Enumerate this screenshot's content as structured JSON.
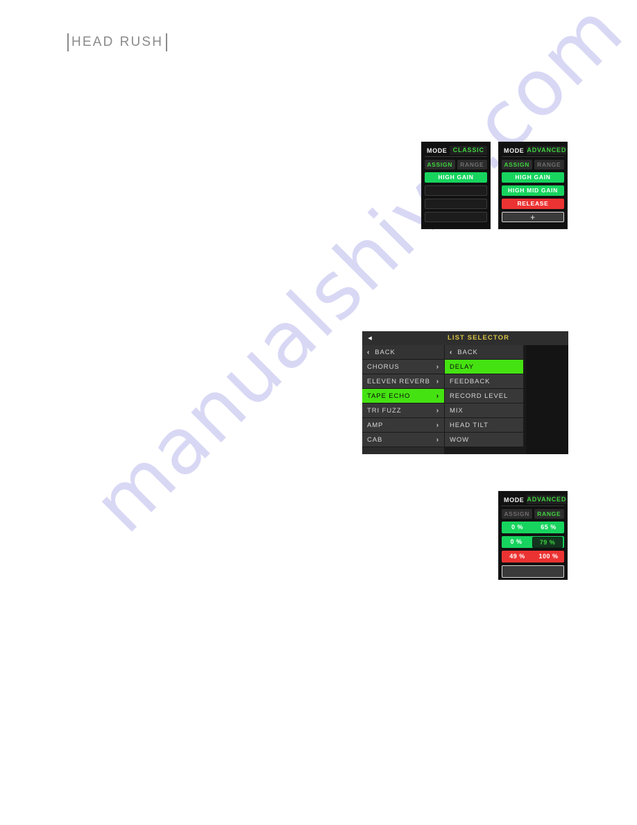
{
  "brand": {
    "name": "HEADRUSH",
    "word_head": "HEAD",
    "word_rush": "RUSH"
  },
  "watermark": {
    "text": "manualshive.com",
    "color": "#ccccf2"
  },
  "colors": {
    "accent_green": "#17d45e",
    "bright_green": "#45e212",
    "text_green": "#3fd43f",
    "red": "#ec3333",
    "title_yellow": "#d8c247",
    "panel_dark": "#111111",
    "row_gray": "#383838"
  },
  "assign_panel_classic": {
    "mode_label": "MODE",
    "mode_value": "CLASSIC",
    "tabs": [
      {
        "label": "ASSIGN",
        "active": true
      },
      {
        "label": "RANGE",
        "active": false
      }
    ],
    "slots": [
      {
        "label": "HIGH GAIN",
        "state": "green"
      },
      {
        "label": "",
        "state": "empty"
      },
      {
        "label": "",
        "state": "empty"
      },
      {
        "label": "",
        "state": "empty"
      }
    ]
  },
  "assign_panel_advanced": {
    "mode_label": "MODE",
    "mode_value": "ADVANCED",
    "tabs": [
      {
        "label": "ASSIGN",
        "active": true
      },
      {
        "label": "RANGE",
        "active": false
      }
    ],
    "slots": [
      {
        "label": "HIGH GAIN",
        "state": "green"
      },
      {
        "label": "HIGH MID GAIN",
        "state": "green"
      },
      {
        "label": "RELEASE",
        "state": "red"
      },
      {
        "label": "+",
        "state": "add"
      }
    ]
  },
  "range_panel": {
    "mode_label": "MODE",
    "mode_value": "ADVANCED",
    "tabs": [
      {
        "label": "ASSIGN",
        "active": false
      },
      {
        "label": "RANGE",
        "active": true
      }
    ],
    "rows": [
      {
        "min": "0 %",
        "max": "65 %",
        "state": "green",
        "editing": false
      },
      {
        "min": "0 %",
        "max": "79 %",
        "state": "green",
        "editing": true
      },
      {
        "min": "49 %",
        "max": "100 %",
        "state": "red",
        "editing": false
      },
      {
        "min": "",
        "max": "",
        "state": "empty",
        "editing": false
      }
    ]
  },
  "list_selector": {
    "back_arrow_icon": "triangle-left-icon",
    "title": "LIST SELECTOR",
    "column_1": {
      "back_label": "BACK",
      "items": [
        {
          "label": "CHORUS",
          "selected": false,
          "chevron": "›"
        },
        {
          "label": "ELEVEN REVERB",
          "selected": false,
          "chevron": "›"
        },
        {
          "label": "TAPE ECHO",
          "selected": true,
          "chevron": "›"
        },
        {
          "label": "TRI FUZZ",
          "selected": false,
          "chevron": "›"
        },
        {
          "label": "AMP",
          "selected": false,
          "chevron": "›"
        },
        {
          "label": "CAB",
          "selected": false,
          "chevron": "›"
        }
      ]
    },
    "column_2": {
      "back_label": "BACK",
      "items": [
        {
          "label": "DELAY",
          "selected": true
        },
        {
          "label": "FEEDBACK",
          "selected": false
        },
        {
          "label": "RECORD LEVEL",
          "selected": false
        },
        {
          "label": "MIX",
          "selected": false
        },
        {
          "label": "HEAD TILT",
          "selected": false
        },
        {
          "label": "WOW",
          "selected": false
        }
      ]
    }
  }
}
